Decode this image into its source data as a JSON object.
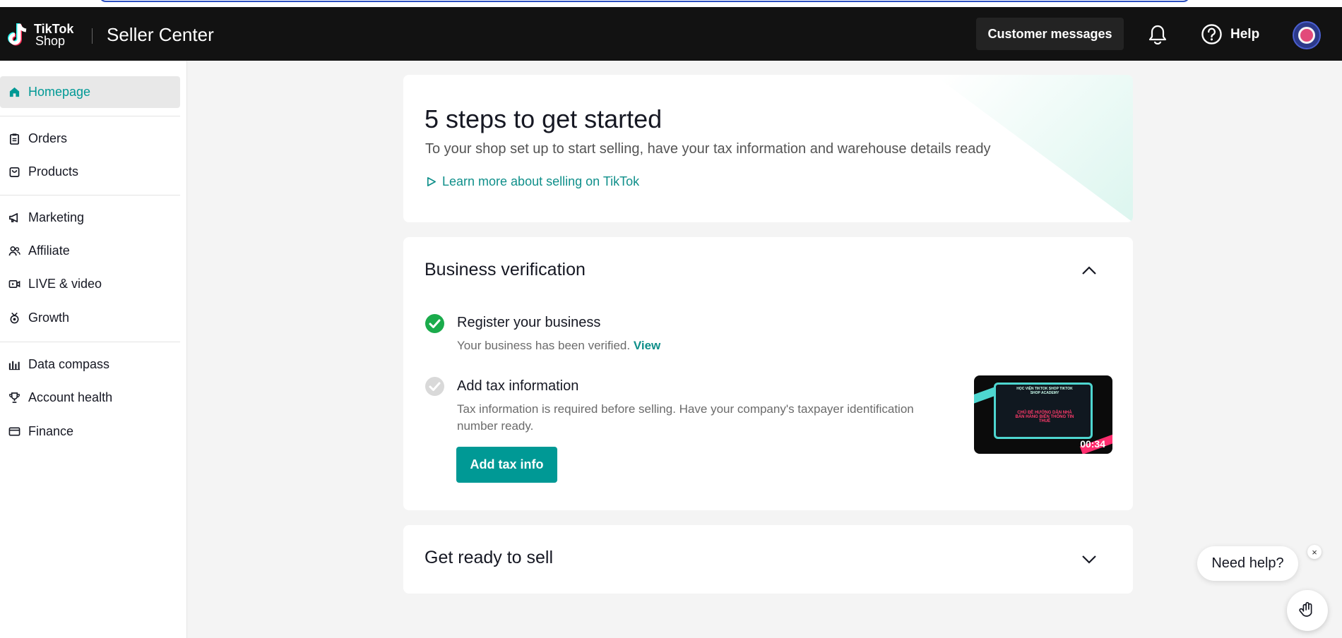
{
  "header": {
    "logo_line1": "TikTok",
    "logo_line2": "Shop",
    "app_title": "Seller Center",
    "customer_messages": "Customer messages",
    "help": "Help"
  },
  "sidebar": {
    "items": [
      {
        "label": "Homepage",
        "icon": "home-icon"
      },
      {
        "label": "Orders",
        "icon": "clipboard-icon"
      },
      {
        "label": "Products",
        "icon": "bag-icon"
      },
      {
        "label": "Marketing",
        "icon": "megaphone-icon"
      },
      {
        "label": "Affiliate",
        "icon": "people-icon"
      },
      {
        "label": "LIVE & video",
        "icon": "video-icon"
      },
      {
        "label": "Growth",
        "icon": "medal-icon"
      },
      {
        "label": "Data compass",
        "icon": "bar-chart-icon"
      },
      {
        "label": "Account health",
        "icon": "trophy-icon"
      },
      {
        "label": "Finance",
        "icon": "card-icon"
      }
    ]
  },
  "hero": {
    "title": "5 steps to get started",
    "subtitle": "To your shop set up to start selling, have your tax information and warehouse details ready",
    "link": "Learn more about selling on TikTok"
  },
  "verification": {
    "title": "Business verification",
    "steps": [
      {
        "title": "Register your business",
        "desc": "Your business has been verified.",
        "link": "View",
        "status": "done"
      },
      {
        "title": "Add tax information",
        "desc": "Tax information is required before selling. Have your company's taxpayer identification number ready.",
        "status": "pending"
      }
    ],
    "button": "Add tax info",
    "video": {
      "heading": "HỌC VIỆN TIKTOK SHOP\nTIKTOK SHOP ACADEMY",
      "topic": "CHỦ ĐỀ\nHƯỚNG DẪN NHÀ BÁN HÀNG\nBIỂN THÔNG TIN THUẾ",
      "duration": "00:34"
    }
  },
  "ready": {
    "title": "Get ready to sell"
  },
  "support": {
    "need_help": "Need help?",
    "close": "×"
  },
  "colors": {
    "accent": "#009995",
    "topbar": "#121212",
    "success": "#1aab4b"
  }
}
